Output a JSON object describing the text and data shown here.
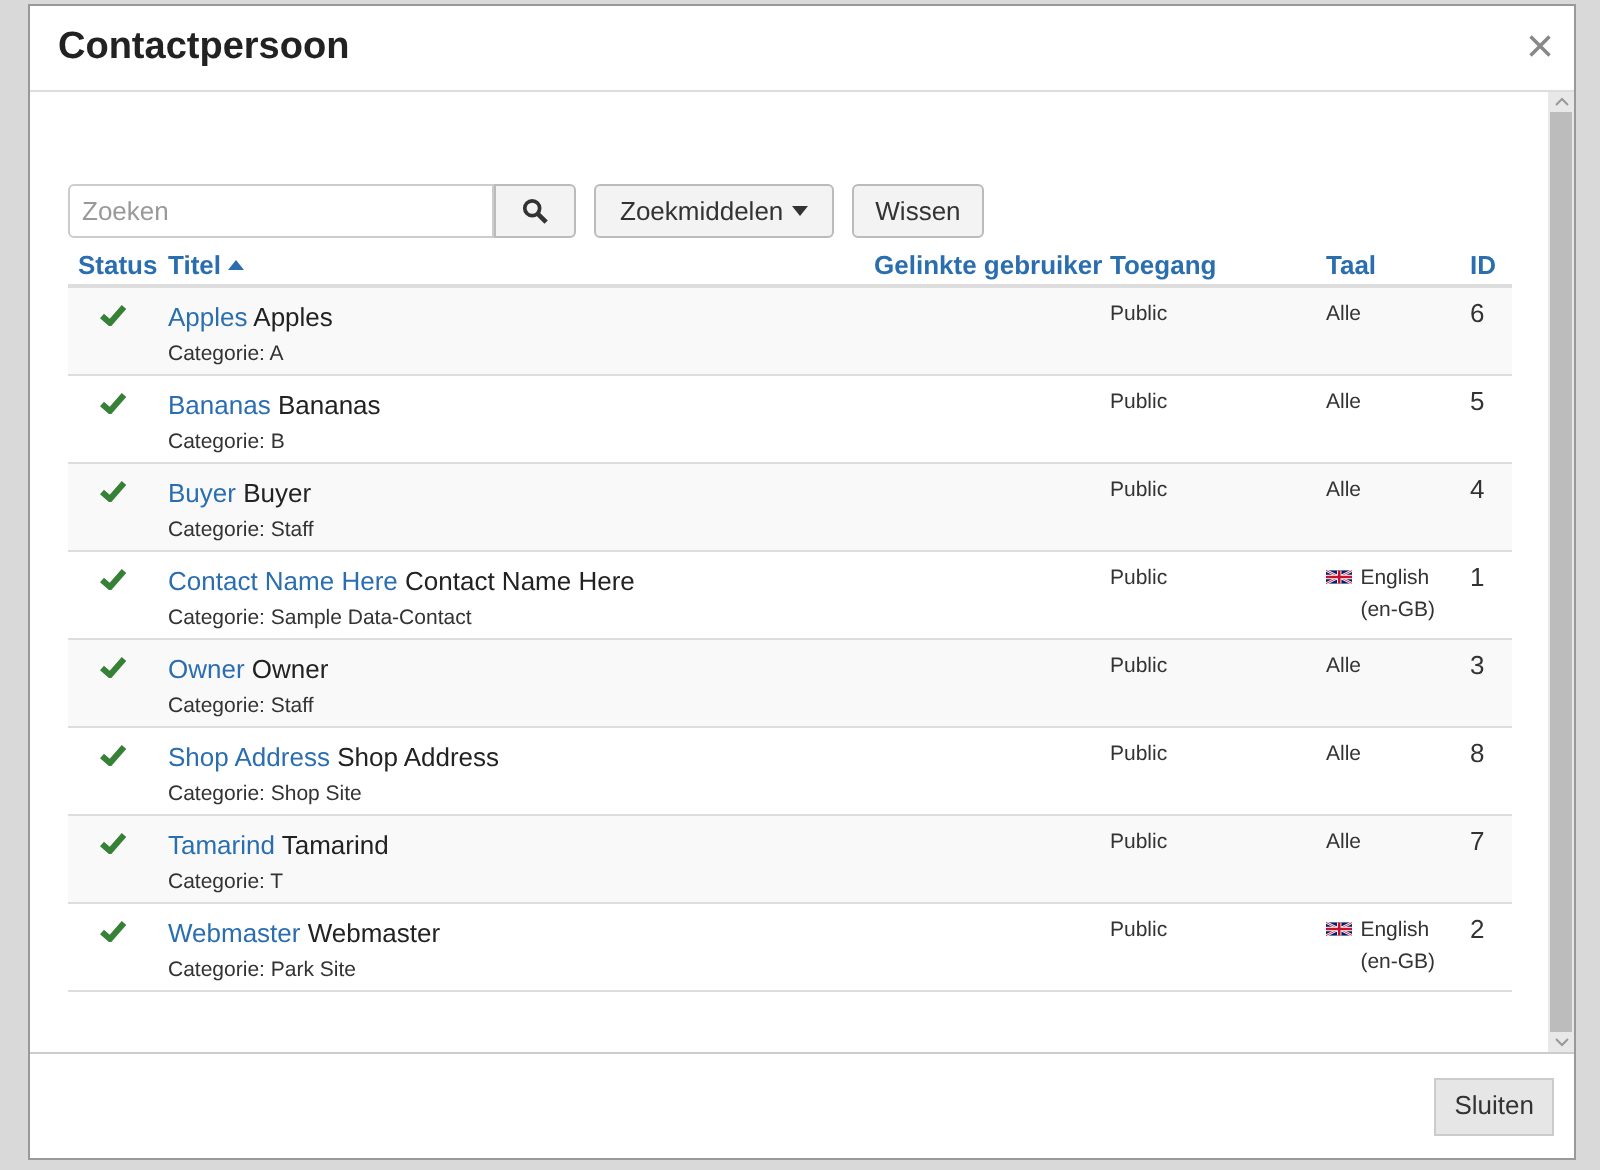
{
  "dialog": {
    "title": "Contactpersoon",
    "close": "×"
  },
  "search": {
    "placeholder": "Zoeken",
    "tools_button": "Zoekmiddelen",
    "clear_button": "Wissen"
  },
  "table": {
    "columns": [
      {
        "label": "Status",
        "sorted": false
      },
      {
        "label": "Titel",
        "sorted": true
      },
      {
        "label": "Gelinkte gebruiker",
        "sorted": false
      },
      {
        "label": "Toegang",
        "sorted": false
      },
      {
        "label": "Taal",
        "sorted": false
      },
      {
        "label": "ID",
        "sorted": false
      }
    ],
    "rows": [
      {
        "published": true,
        "link": "Apples",
        "name": "Apples",
        "category": "Categorie: A",
        "access": "Public",
        "language": {
          "kind": "all",
          "text": "Alle"
        },
        "id": "6"
      },
      {
        "published": true,
        "link": "Bananas",
        "name": "Bananas",
        "category": "Categorie: B",
        "access": "Public",
        "language": {
          "kind": "all",
          "text": "Alle"
        },
        "id": "5"
      },
      {
        "published": true,
        "link": "Buyer",
        "name": "Buyer",
        "category": "Categorie: Staff",
        "access": "Public",
        "language": {
          "kind": "all",
          "text": "Alle"
        },
        "id": "4"
      },
      {
        "published": true,
        "link": "Contact Name Here",
        "name": "Contact Name Here",
        "category": "Categorie: Sample Data-Contact",
        "access": "Public",
        "language": {
          "kind": "flag",
          "text": "English (en-GB)"
        },
        "id": "1"
      },
      {
        "published": true,
        "link": "Owner",
        "name": "Owner",
        "category": "Categorie: Staff",
        "access": "Public",
        "language": {
          "kind": "all",
          "text": "Alle"
        },
        "id": "3"
      },
      {
        "published": true,
        "link": "Shop Address",
        "name": "Shop Address",
        "category": "Categorie: Shop Site",
        "access": "Public",
        "language": {
          "kind": "all",
          "text": "Alle"
        },
        "id": "8"
      },
      {
        "published": true,
        "link": "Tamarind",
        "name": "Tamarind",
        "category": "Categorie: T",
        "access": "Public",
        "language": {
          "kind": "all",
          "text": "Alle"
        },
        "id": "7"
      },
      {
        "published": true,
        "link": "Webmaster",
        "name": "Webmaster",
        "category": "Categorie: Park Site",
        "access": "Public",
        "language": {
          "kind": "flag",
          "text": "English (en-GB)"
        },
        "id": "2"
      }
    ]
  },
  "footer": {
    "close_button": "Sluiten"
  }
}
